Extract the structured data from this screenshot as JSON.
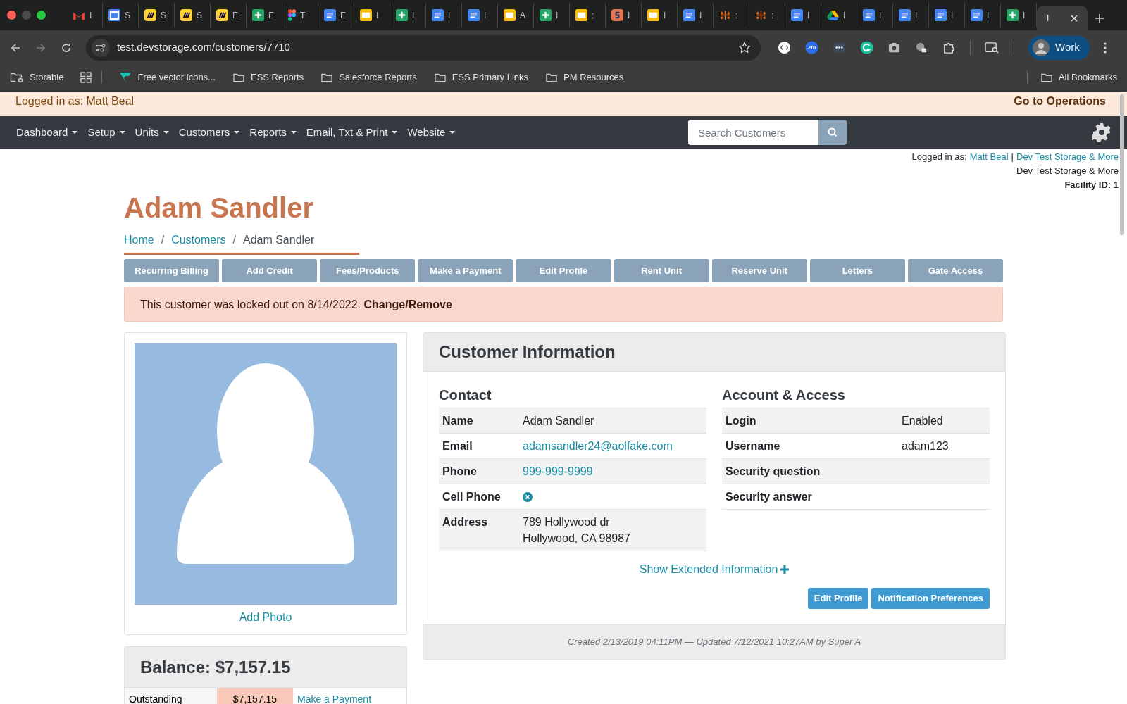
{
  "browser": {
    "tabs": [
      {
        "kind": "gmail",
        "title": "I",
        "selected": false
      },
      {
        "kind": "calendar",
        "title": "S",
        "selected": false
      },
      {
        "kind": "miro",
        "title": "S",
        "selected": false
      },
      {
        "kind": "miro",
        "title": "S",
        "selected": false
      },
      {
        "kind": "miro",
        "title": "E",
        "selected": false
      },
      {
        "kind": "sheets",
        "title": "E",
        "selected": false
      },
      {
        "kind": "figma",
        "title": "T",
        "selected": false
      },
      {
        "kind": "docs",
        "title": "E",
        "selected": false
      },
      {
        "kind": "slides",
        "title": "I",
        "selected": false
      },
      {
        "kind": "sheets",
        "title": "I",
        "selected": false
      },
      {
        "kind": "docs",
        "title": "I",
        "selected": false
      },
      {
        "kind": "docs",
        "title": "I",
        "selected": false
      },
      {
        "kind": "slides",
        "title": "A",
        "selected": false
      },
      {
        "kind": "sheets",
        "title": "I",
        "selected": false
      },
      {
        "kind": "slides",
        "title": ":",
        "selected": false
      },
      {
        "kind": "storyboard",
        "title": "I",
        "selected": false
      },
      {
        "kind": "slides",
        "title": "I",
        "selected": false
      },
      {
        "kind": "docs",
        "title": "I",
        "selected": false
      },
      {
        "kind": "tableau",
        "title": ":",
        "selected": false
      },
      {
        "kind": "tableau",
        "title": ":",
        "selected": false
      },
      {
        "kind": "docs",
        "title": "I",
        "selected": false
      },
      {
        "kind": "drive",
        "title": "I",
        "selected": false
      },
      {
        "kind": "docs",
        "title": "I",
        "selected": false
      },
      {
        "kind": "docs",
        "title": "I",
        "selected": false
      },
      {
        "kind": "docs",
        "title": "I",
        "selected": false
      },
      {
        "kind": "docs",
        "title": "I",
        "selected": false
      },
      {
        "kind": "sheets",
        "title": "I",
        "selected": false
      },
      {
        "kind": "blank",
        "title": "I",
        "selected": true
      }
    ],
    "address": "test.devstorage.com/customers/7710",
    "profile": "Work",
    "bookmarks": [
      {
        "kind": "folder_gear",
        "label": "Storable"
      },
      {
        "kind": "grid"
      },
      {
        "kind": "vector",
        "label": "Free vector icons..."
      },
      {
        "kind": "folder",
        "label": "ESS Reports"
      },
      {
        "kind": "folder",
        "label": "Salesforce Reports"
      },
      {
        "kind": "folder",
        "label": "ESS Primary Links"
      },
      {
        "kind": "folder",
        "label": "PM Resources"
      }
    ],
    "all_bookmarks": "All Bookmarks"
  },
  "banner": {
    "logged_in": "Logged in as: Matt Beal",
    "link": "Go to Operations"
  },
  "nav": {
    "menus": [
      "Dashboard",
      "Setup",
      "Units",
      "Customers",
      "Reports",
      "Email, Txt & Print",
      "Website"
    ],
    "search_placeholder": "Search Customers"
  },
  "session": {
    "prefix": "Logged in as:",
    "user": "Matt Beal",
    "separator": "|",
    "facility_link": "Dev Test Storage & More",
    "facility_name": "Dev Test Storage & More",
    "facility_id": "Facility ID: 1"
  },
  "title": "Adam Sandler",
  "breadcrumbs": [
    {
      "label": "Home",
      "link": true
    },
    {
      "separator": "/",
      "label": "Customers",
      "link": true
    },
    {
      "separator": "/",
      "label": "Adam Sandler",
      "link": false
    }
  ],
  "actions": [
    "Recurring Billing",
    "Add Credit",
    "Fees/Products",
    "Make a Payment",
    "Edit Profile",
    "Rent Unit",
    "Reserve Unit",
    "Letters",
    "Gate Access"
  ],
  "alert": "This customer was locked out on 8/14/2022. **Change/Remove**",
  "photo": {
    "add_photo": "Add Photo"
  },
  "balance": {
    "title": "Balance: $7,157.15",
    "row": {
      "label": "Outstanding",
      "amount": "$7,157.15",
      "link": "Make a Payment"
    }
  },
  "customer_info": {
    "title": "Customer Information",
    "contact": {
      "heading": "Contact",
      "rows": [
        {
          "label": "Name",
          "kind": "text",
          "lines": [
            "Adam Sandler"
          ]
        },
        {
          "label": "Email",
          "kind": "link",
          "lines": [
            "adamsandler24@aolfake.com"
          ]
        },
        {
          "label": "Phone",
          "kind": "link",
          "lines": [
            "999-999-9999"
          ]
        },
        {
          "label": "Cell Phone",
          "kind": "missing"
        },
        {
          "label": "Address",
          "kind": "text",
          "lines": [
            "789 Hollywood dr",
            "Hollywood, CA 98987"
          ]
        }
      ]
    },
    "account": {
      "heading": "Account & Access",
      "rows": [
        {
          "label": "Login",
          "kind": "text",
          "lines": [
            "Enabled"
          ]
        },
        {
          "label": "Username",
          "kind": "text",
          "lines": [
            "adam123"
          ]
        },
        {
          "label": "Security question",
          "kind": "text"
        },
        {
          "label": "Security answer",
          "kind": "text"
        }
      ]
    },
    "show_extended": "Show Extended Information",
    "buttons": [
      "Edit Profile",
      "Notification Preferences"
    ],
    "footer": "Created 2/13/2019 04:11PM — Updated 7/12/2021 10:27AM by Super A"
  }
}
